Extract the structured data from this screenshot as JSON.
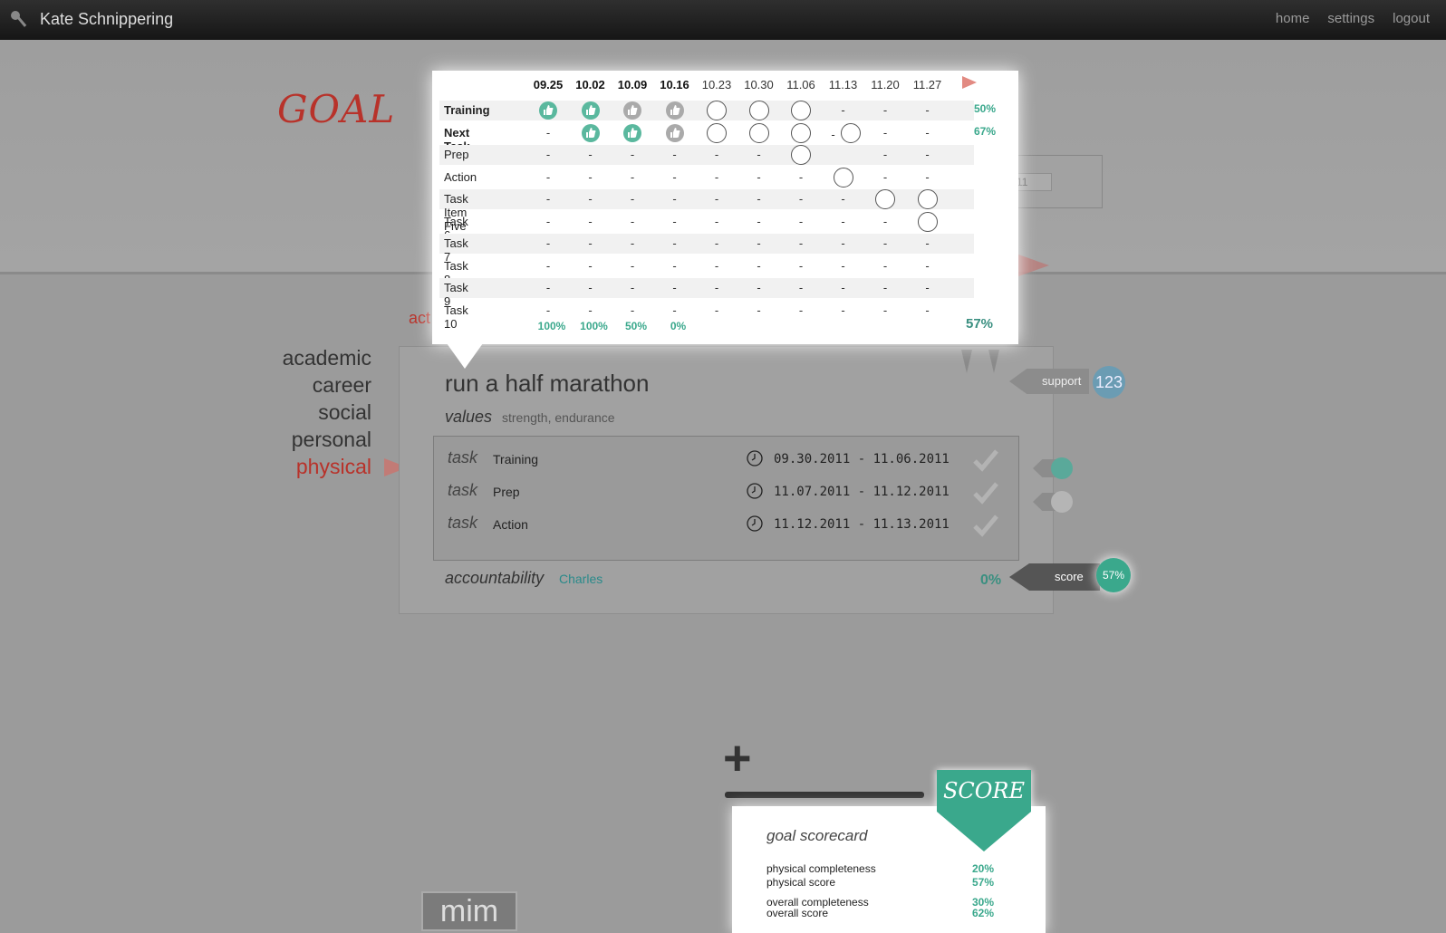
{
  "header": {
    "user_name": "Kate Schnippering",
    "nav": [
      "home",
      "settings",
      "logout"
    ]
  },
  "page": {
    "goal_title": "GOAL",
    "dim_select_value": "11",
    "active_category_label": "act"
  },
  "categories": [
    "academic",
    "career",
    "social",
    "personal",
    "physical"
  ],
  "active_category": "physical",
  "goal": {
    "name": "run a half marathon",
    "values_label": "values",
    "values": "strength, endurance",
    "tasks": [
      {
        "label": "task",
        "name": "Training",
        "dates": "09.30.2011 - 11.06.2011"
      },
      {
        "label": "task",
        "name": "Prep",
        "dates": "11.07.2011 - 11.12.2011"
      },
      {
        "label": "task",
        "name": "Action",
        "dates": "11.12.2011 - 11.13.2011"
      }
    ],
    "accountability_label": "accountability",
    "accountability_value": "Charles",
    "completion": "0%"
  },
  "tags": {
    "support_label": "support",
    "support_count": "123",
    "score_label": "score",
    "score_value": "57%"
  },
  "tracker": {
    "weeks": [
      "09.25",
      "10.02",
      "10.09",
      "10.16",
      "10.23",
      "10.30",
      "11.06",
      "11.13",
      "11.20",
      "11.27"
    ],
    "bold_weeks": [
      0,
      1,
      2,
      3
    ],
    "rows": [
      {
        "name": "Training",
        "bold": true,
        "pct": "50%",
        "cells": [
          "tg",
          "tg",
          "tx",
          "tx",
          "o",
          "o",
          "o",
          "-",
          "-",
          "-"
        ]
      },
      {
        "name": "Next Task Item",
        "bold": true,
        "pct": "67%",
        "cells": [
          "-",
          "tg",
          "tg",
          "tx",
          "o",
          "o",
          "o",
          "-o",
          "-",
          "-"
        ]
      },
      {
        "name": "Prep",
        "bold": false,
        "pct": "",
        "cells": [
          "-",
          "-",
          "-",
          "-",
          "-",
          "-",
          "o",
          "",
          "-",
          "-"
        ]
      },
      {
        "name": "Action",
        "bold": false,
        "pct": "",
        "cells": [
          "-",
          "-",
          "-",
          "-",
          "-",
          "-",
          "-",
          "o",
          "-",
          "-"
        ]
      },
      {
        "name": "Task Item Five",
        "bold": false,
        "pct": "",
        "cells": [
          "-",
          "-",
          "-",
          "-",
          "-",
          "-",
          "-",
          "-",
          "o",
          "o"
        ]
      },
      {
        "name": "Task 6",
        "bold": false,
        "pct": "",
        "cells": [
          "-",
          "-",
          "-",
          "-",
          "-",
          "-",
          "-",
          "-",
          "-",
          "o"
        ]
      },
      {
        "name": "Task 7",
        "bold": false,
        "pct": "",
        "cells": [
          "-",
          "-",
          "-",
          "-",
          "-",
          "-",
          "-",
          "-",
          "-",
          "-"
        ]
      },
      {
        "name": "Task 8",
        "bold": false,
        "pct": "",
        "cells": [
          "-",
          "-",
          "-",
          "-",
          "-",
          "-",
          "-",
          "-",
          "-",
          "-"
        ]
      },
      {
        "name": "Task 9",
        "bold": false,
        "pct": "",
        "cells": [
          "-",
          "-",
          "-",
          "-",
          "-",
          "-",
          "-",
          "-",
          "-",
          "-"
        ]
      },
      {
        "name": "Task 10",
        "bold": false,
        "pct": "",
        "cells": [
          "-",
          "-",
          "-",
          "-",
          "-",
          "-",
          "-",
          "-",
          "-",
          "-"
        ]
      }
    ],
    "column_pcts": [
      "100%",
      "100%",
      "50%",
      "0%"
    ],
    "total_pct": "57%"
  },
  "scorecard": {
    "banner": "SCORE",
    "title": "goal scorecard",
    "rows": [
      {
        "label": "physical completeness",
        "value": "20%"
      },
      {
        "label": "physical score",
        "value": "57%"
      },
      {
        "label": "overall completeness",
        "value": "30%"
      },
      {
        "label": "overall score",
        "value": "62%"
      }
    ]
  },
  "bottom_label": "mim",
  "colors": {
    "accent_red": "#b8322a",
    "accent_green": "#3aa88c",
    "topbar": "#1e1e1e",
    "link_teal": "#2a8a8a"
  }
}
